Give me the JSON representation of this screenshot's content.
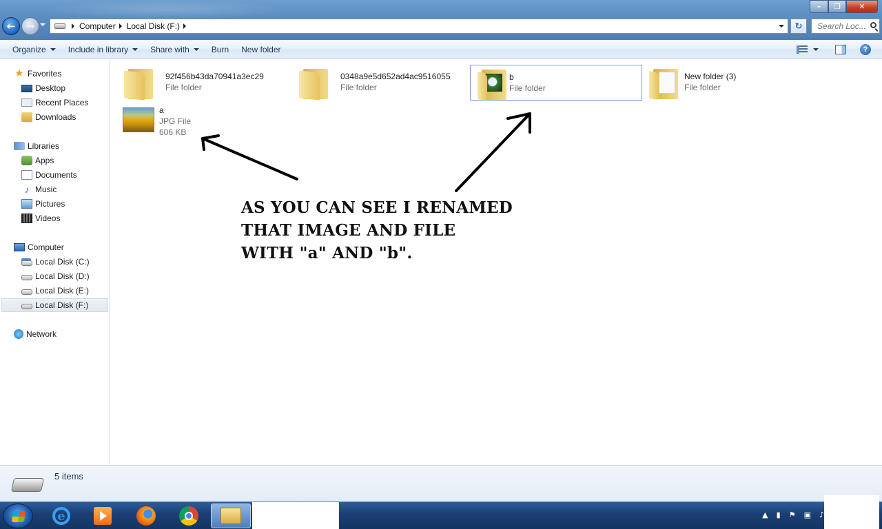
{
  "window": {
    "back_glyph": "←",
    "forward_glyph": "→",
    "breadcrumbs": [
      "Computer",
      "Local Disk (F:)"
    ],
    "search_placeholder": "Search Loc...",
    "refresh_glyph": "↻",
    "controls": {
      "minimize": "–",
      "maximize": "❐",
      "close": "✕"
    }
  },
  "toolbar": {
    "organize": "Organize",
    "include_in_library": "Include in library",
    "share_with": "Share with",
    "burn": "Burn",
    "new_folder": "New folder",
    "help": "?"
  },
  "navpane": {
    "favorites": {
      "label": "Favorites",
      "icon": "star-icon",
      "items": [
        "Desktop",
        "Recent Places",
        "Downloads"
      ]
    },
    "libraries": {
      "label": "Libraries",
      "icon": "libraries-icon",
      "items": [
        "Apps",
        "Documents",
        "Music",
        "Pictures",
        "Videos"
      ]
    },
    "computer": {
      "label": "Computer",
      "icon": "computer-icon",
      "items": [
        "Local Disk (C:)",
        "Local Disk (D:)",
        "Local Disk (E:)",
        "Local Disk (F:)"
      ],
      "selected": "Local Disk (F:)"
    },
    "network": {
      "label": "Network",
      "icon": "network-icon"
    }
  },
  "files": [
    {
      "name": "92f456b43da70941a3ec29",
      "type": "File folder",
      "icon": "folder-icon"
    },
    {
      "name": "0348a9e5d652ad4ac9516055",
      "type": "File folder",
      "icon": "folder-icon"
    },
    {
      "name": "b",
      "type": "File folder",
      "icon": "folder-photo-icon",
      "selected": true
    },
    {
      "name": "New folder (3)",
      "type": "File folder",
      "icon": "folder-doc-icon"
    },
    {
      "name": "a",
      "type": "JPG File",
      "size": "606 KB",
      "icon": "jpg-thumbnail"
    }
  ],
  "annotation": {
    "lines": [
      "AS YOU CAN SEE I RENAMED",
      "THAT IMAGE AND FILE",
      "WITH \"a\" AND \"b\"."
    ]
  },
  "details": {
    "item_count": "5 items"
  },
  "taskbar": {
    "apps": [
      "internet-explorer-icon",
      "media-player-icon",
      "firefox-icon",
      "chrome-icon",
      "windows-explorer-icon"
    ],
    "tray_icons": [
      "show-hidden-icons",
      "network-signal-icon",
      "action-center-flag-icon",
      "power-icon",
      "volume-icon"
    ]
  }
}
